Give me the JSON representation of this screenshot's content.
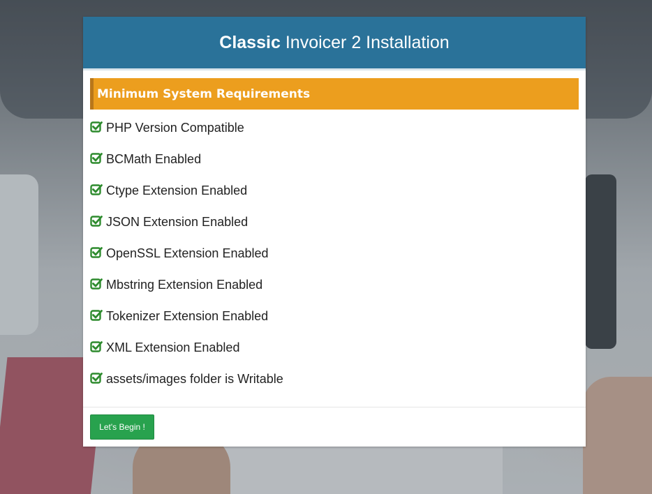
{
  "header": {
    "title_bold": "Classic",
    "title_rest": "Invoicer 2 Installation"
  },
  "requirements": {
    "heading": "Minimum System Requirements",
    "items": [
      {
        "label": "PHP Version Compatible",
        "icon": "check-square-icon",
        "status": "ok"
      },
      {
        "label": "BCMath Enabled",
        "icon": "check-square-icon",
        "status": "ok"
      },
      {
        "label": "Ctype Extension Enabled",
        "icon": "check-square-icon",
        "status": "ok"
      },
      {
        "label": "JSON Extension Enabled",
        "icon": "check-square-icon",
        "status": "ok"
      },
      {
        "label": "OpenSSL Extension Enabled",
        "icon": "check-square-icon",
        "status": "ok"
      },
      {
        "label": "Mbstring Extension Enabled",
        "icon": "check-square-icon",
        "status": "ok"
      },
      {
        "label": "Tokenizer Extension Enabled",
        "icon": "check-square-icon",
        "status": "ok"
      },
      {
        "label": "XML Extension Enabled",
        "icon": "check-square-icon",
        "status": "ok"
      },
      {
        "label": "assets/images folder is Writable",
        "icon": "check-square-icon",
        "status": "ok"
      }
    ]
  },
  "footer": {
    "begin_label": "Let's Begin !"
  },
  "colors": {
    "header_bg": "#2a7299",
    "banner_bg": "#ec9e1e",
    "check": "#2e8b2e",
    "button_bg": "#28a24e"
  }
}
